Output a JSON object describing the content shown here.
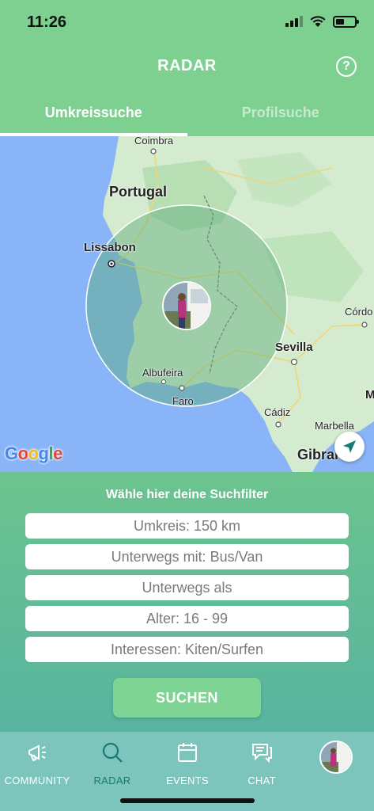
{
  "status_bar": {
    "time": "11:26"
  },
  "header": {
    "title": "RADAR",
    "help_label": "?"
  },
  "tabs": [
    {
      "label": "Umkreissuche",
      "active": true
    },
    {
      "label": "Profilsuche",
      "active": false
    }
  ],
  "map": {
    "labels": {
      "coimbra": "Coimbra",
      "portugal": "Portugal",
      "lissabon": "Lissabon",
      "cordoba": "Córdo",
      "sevilla": "Sevilla",
      "albufeira": "Albufeira",
      "faro": "Faro",
      "cadiz": "Cádiz",
      "marbella": "Marbella",
      "gibraltar": "Gibral",
      "malaga_m": "M"
    },
    "attribution": "Google",
    "locate_icon": "navigation-arrow-icon",
    "colors": {
      "water": "#8ab4f8",
      "land": "#cde8c6",
      "radius": "rgba(90,170,120,0.45)"
    }
  },
  "filters": {
    "heading": "Wähle hier deine Suchfilter",
    "items": [
      "Umkreis: 150 km",
      "Unterwegs mit: Bus/Van",
      "Unterwegs als",
      "Alter: 16 - 99",
      "Interessen: Kiten/Surfen"
    ],
    "search_label": "SUCHEN"
  },
  "nav": {
    "items": [
      {
        "label": "COMMUNITY",
        "icon": "megaphone-icon"
      },
      {
        "label": "RADAR",
        "icon": "search-icon",
        "active": true
      },
      {
        "label": "EVENTS",
        "icon": "calendar-icon"
      },
      {
        "label": "CHAT",
        "icon": "chat-icon"
      }
    ],
    "profile_icon": "profile-avatar"
  },
  "colors": {
    "header": "#7ed090",
    "accent_active": "#167b74",
    "nav_bg": "#7cc4bc",
    "search_button": "#7ed492"
  }
}
